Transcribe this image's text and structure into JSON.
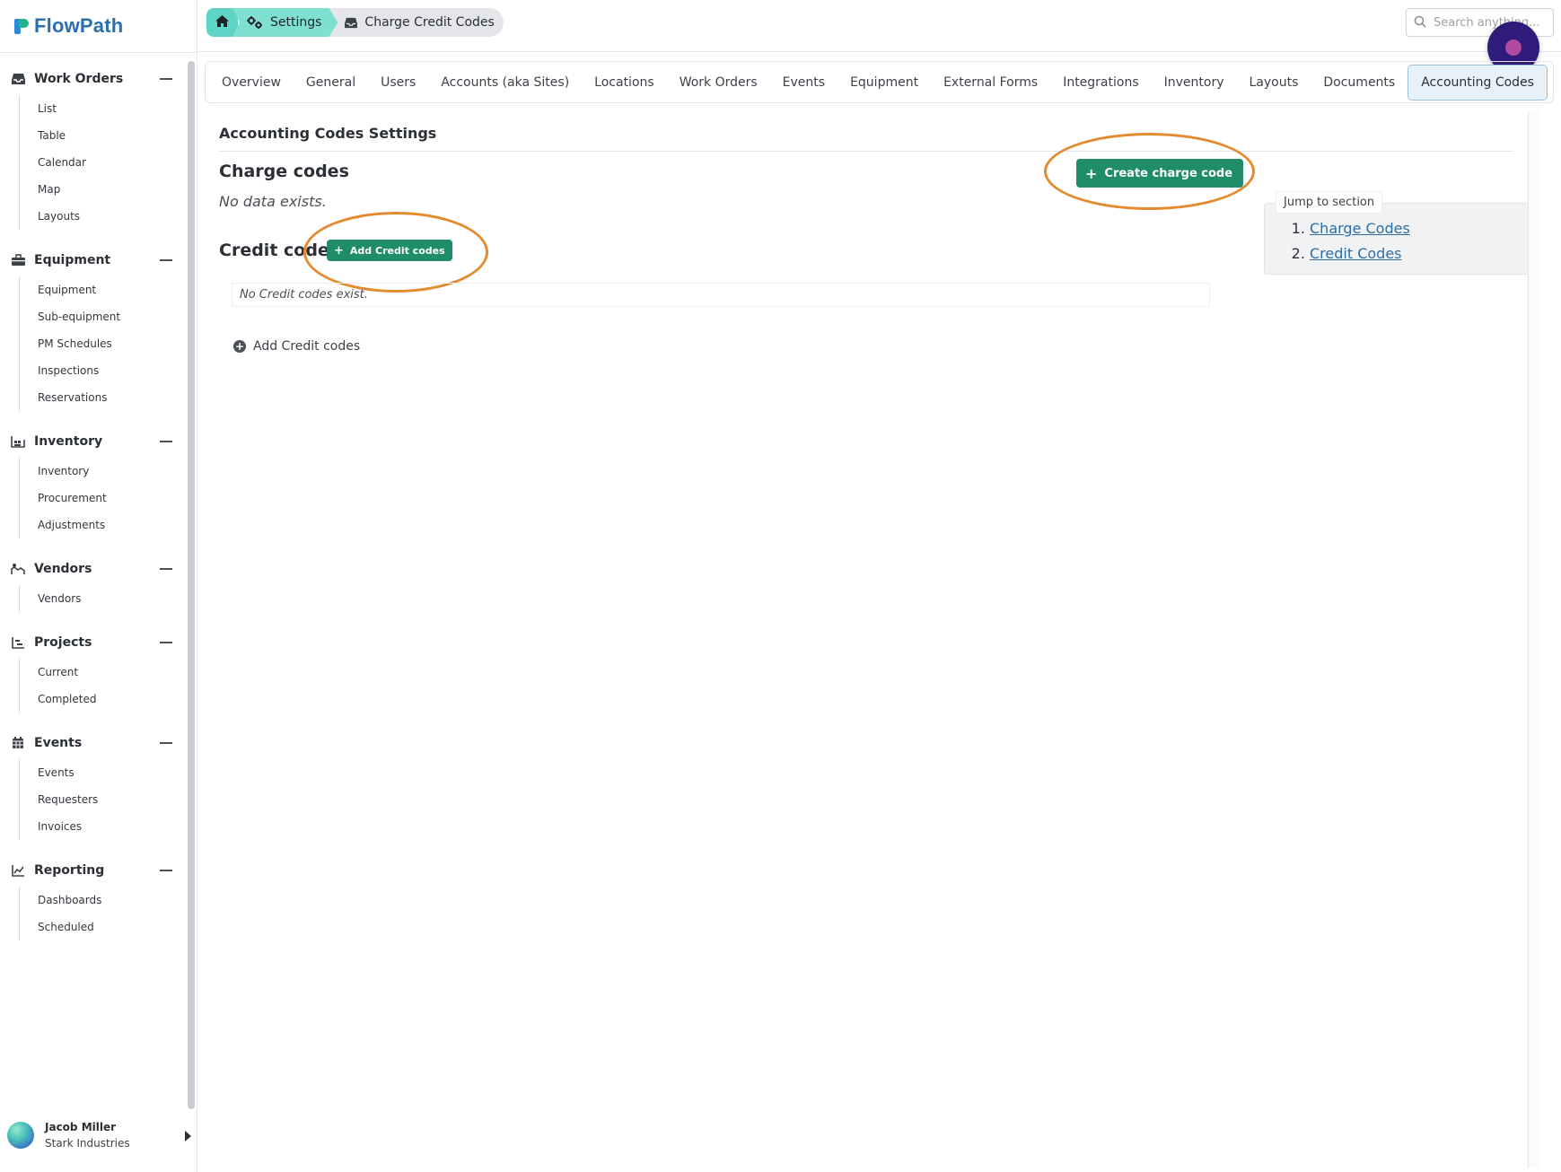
{
  "app": {
    "name": "FlowPath"
  },
  "breadcrumb": {
    "settings": "Settings",
    "current": "Charge Credit Codes"
  },
  "search": {
    "placeholder": "Search anything..."
  },
  "tabs": [
    {
      "label": "Overview"
    },
    {
      "label": "General"
    },
    {
      "label": "Users"
    },
    {
      "label": "Accounts (aka Sites)"
    },
    {
      "label": "Locations"
    },
    {
      "label": "Work Orders"
    },
    {
      "label": "Events"
    },
    {
      "label": "Equipment"
    },
    {
      "label": "External Forms"
    },
    {
      "label": "Integrations"
    },
    {
      "label": "Inventory"
    },
    {
      "label": "Layouts"
    },
    {
      "label": "Documents"
    },
    {
      "label": "Accounting Codes",
      "active": true
    }
  ],
  "sidebar": {
    "sections": [
      {
        "title": "Work Orders",
        "icon": "inbox-icon",
        "items": [
          "List",
          "Table",
          "Calendar",
          "Map",
          "Layouts"
        ]
      },
      {
        "title": "Equipment",
        "icon": "toolbox-icon",
        "items": [
          "Equipment",
          "Sub-equipment",
          "PM Schedules",
          "Inspections",
          "Reservations"
        ]
      },
      {
        "title": "Inventory",
        "icon": "warehouse-icon",
        "items": [
          "Inventory",
          "Procurement",
          "Adjustments"
        ]
      },
      {
        "title": "Vendors",
        "icon": "handshake-icon",
        "items": [
          "Vendors"
        ]
      },
      {
        "title": "Projects",
        "icon": "chart-icon",
        "items": [
          "Current",
          "Completed"
        ]
      },
      {
        "title": "Events",
        "icon": "calendar-icon",
        "items": [
          "Events",
          "Requesters",
          "Invoices"
        ]
      },
      {
        "title": "Reporting",
        "icon": "line-chart-icon",
        "items": [
          "Dashboards",
          "Scheduled"
        ]
      }
    ]
  },
  "user": {
    "name": "Jacob Miller",
    "org": "Stark Industries"
  },
  "content": {
    "title": "Accounting Codes Settings",
    "charge_heading": "Charge codes",
    "charge_empty": "No data exists.",
    "create_button": "Create charge code",
    "credit_heading": "Credit codes",
    "add_credit_button": "Add Credit codes",
    "credit_empty": "No Credit codes exist.",
    "add_credit_link": "Add Credit codes"
  },
  "jump": {
    "label": "Jump to section",
    "links": [
      "Charge Codes",
      "Credit Codes"
    ]
  },
  "colors": {
    "accent_green": "#1f8c6a",
    "annotation_ring": "#e48a2f",
    "breadcrumb_teal": "#5fd3c4",
    "fab": "#2e1b7a"
  }
}
